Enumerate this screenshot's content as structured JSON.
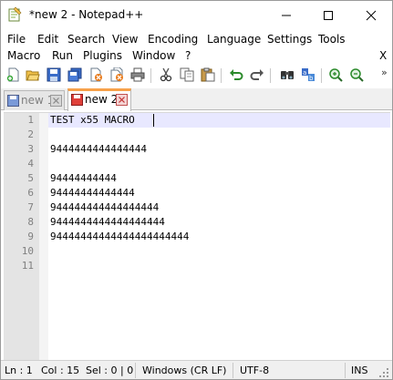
{
  "window": {
    "title": "*new 2 - Notepad++"
  },
  "menu": {
    "row1": [
      "File",
      "Edit",
      "Search",
      "View",
      "Encoding",
      "Language",
      "Settings",
      "Tools"
    ],
    "row2": [
      "Macro",
      "Run",
      "Plugins",
      "Window",
      "?"
    ],
    "close_doc": "X"
  },
  "toolbar": {
    "icons": [
      "new-file-icon",
      "open-file-icon",
      "save-icon",
      "save-all-icon",
      "close-icon",
      "close-all-icon",
      "print-icon",
      "cut-icon",
      "copy-icon",
      "paste-icon",
      "undo-icon",
      "redo-icon",
      "find-icon",
      "replace-icon",
      "zoom-in-icon",
      "zoom-out-icon"
    ],
    "overflow": "»"
  },
  "tabs": [
    {
      "label": "new 1",
      "active": false
    },
    {
      "label": "new 2",
      "active": true
    }
  ],
  "editor": {
    "line_numbers": [
      "1",
      "2",
      "3",
      "4",
      "5",
      "6",
      "7",
      "8",
      "9",
      "10",
      "11"
    ],
    "lines": [
      "TEST x55 MACRO",
      "",
      "9444444444444444",
      "",
      "94444444444",
      "94444444444444",
      "944444444444444444",
      "9444444444444444444",
      "94444444444444444444444",
      "",
      ""
    ],
    "current_line": 1
  },
  "status": {
    "line": "Ln : 1",
    "col": "Col : 15",
    "sel": "Sel : 0 | 0",
    "eol": "Windows (CR LF)",
    "encoding": "UTF-8",
    "mode": "INS"
  },
  "colors": {
    "accent": "#f7a14a",
    "current_line_bg": "#e8e8ff",
    "gutter_bg": "#e4e4e4"
  }
}
